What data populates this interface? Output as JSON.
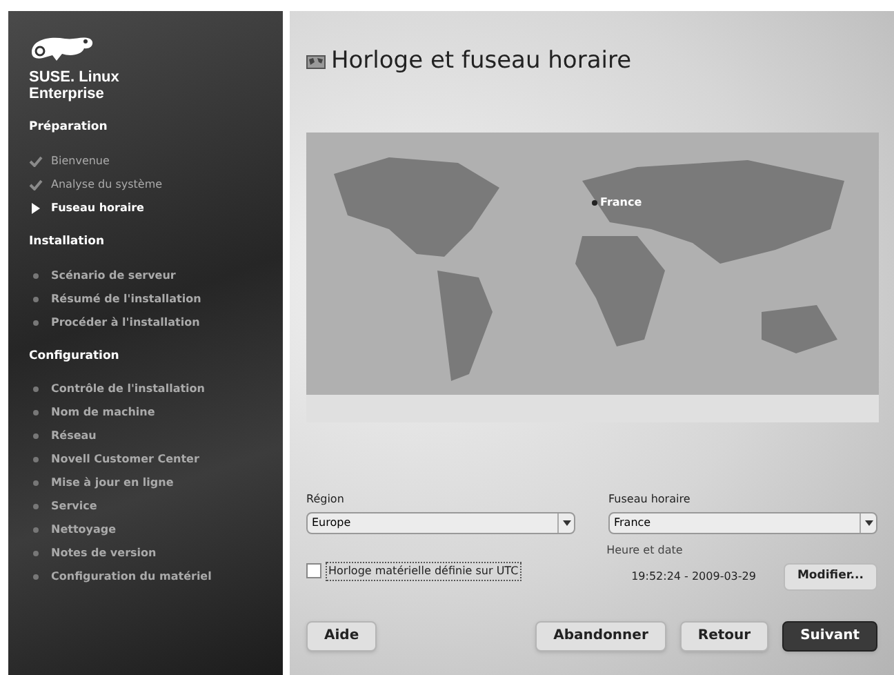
{
  "sidebar": {
    "logo_text": [
      "SUSE. Linux",
      "Enterprise"
    ],
    "sections": [
      {
        "title": "Préparation",
        "items": [
          {
            "label": "Bienvenue",
            "kind": "done"
          },
          {
            "label": "Analyse du système",
            "kind": "done"
          },
          {
            "label": "Fuseau horaire",
            "kind": "current"
          }
        ]
      },
      {
        "title": "Installation",
        "items": [
          {
            "label": "Scénario de serveur",
            "kind": "pending"
          },
          {
            "label": "Résumé de l'installation",
            "kind": "pending"
          },
          {
            "label": "Procéder à l'installation",
            "kind": "pending"
          }
        ]
      },
      {
        "title": "Configuration",
        "items": [
          {
            "label": "Contrôle de l'installation",
            "kind": "pending"
          },
          {
            "label": "Nom de machine",
            "kind": "pending"
          },
          {
            "label": "Réseau",
            "kind": "pending"
          },
          {
            "label": "Novell Customer Center",
            "kind": "pending"
          },
          {
            "label": "Mise à jour en ligne",
            "kind": "pending"
          },
          {
            "label": "Service",
            "kind": "pending"
          },
          {
            "label": "Nettoyage",
            "kind": "pending"
          },
          {
            "label": "Notes de version",
            "kind": "pending"
          },
          {
            "label": "Configuration du matériel",
            "kind": "pending"
          }
        ]
      }
    ]
  },
  "title": "Horloge et fuseau horaire",
  "map": {
    "marker_label": "France"
  },
  "region": {
    "label": "Région",
    "value": "Europe"
  },
  "timezone": {
    "label": "Fuseau horaire",
    "value": "France"
  },
  "utc_checkbox": {
    "label": "Horloge matérielle définie sur UTC",
    "checked": false
  },
  "datetime": {
    "label": "Heure et date",
    "value": "19:52:24 - 2009-03-29",
    "button": "Modifier..."
  },
  "buttons": [
    {
      "label": "Aide",
      "primary": false
    },
    {
      "label": "Abandonner",
      "primary": false
    },
    {
      "label": "Retour",
      "primary": false
    },
    {
      "label": "Suivant",
      "primary": true
    }
  ]
}
